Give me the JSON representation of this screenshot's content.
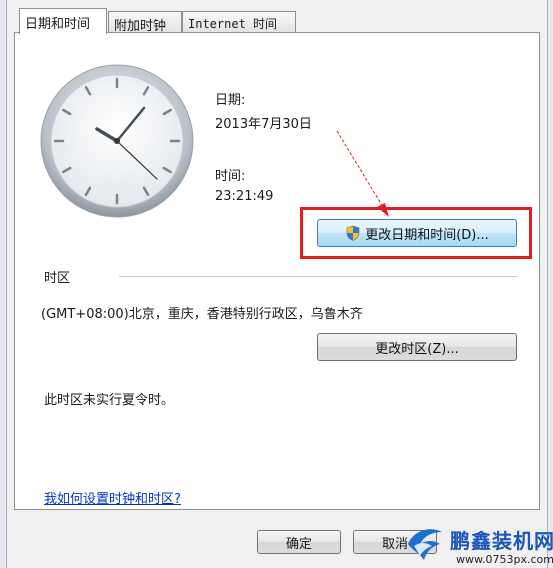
{
  "tabs": [
    {
      "label": "日期和时间",
      "active": true
    },
    {
      "label": "附加时钟",
      "active": false
    },
    {
      "label": "Internet 时间",
      "active": false
    }
  ],
  "datetime": {
    "date_label": "日期:",
    "date_value": "2013年7月30日",
    "time_label": "时间:",
    "time_value": "23:21:49",
    "change_button": "更改日期和时间(D)..."
  },
  "timezone": {
    "section_label": "时区",
    "current": "(GMT+08:00)北京，重庆，香港特别行政区，乌鲁木齐",
    "change_button": "更改时区(Z)...",
    "dst_note": "此时区未实行夏令时。"
  },
  "help_link": "我如何设置时钟和时区?",
  "footer": {
    "ok": "确定",
    "cancel": "取消"
  },
  "watermark": {
    "brand": "鹏鑫装机网",
    "url": "www.0753px.com"
  },
  "colors": {
    "highlight": "#e02020",
    "link": "#0033cc",
    "brand": "#1c57b8"
  },
  "icons": [
    "shield-icon",
    "clock-face",
    "red-arrow"
  ]
}
